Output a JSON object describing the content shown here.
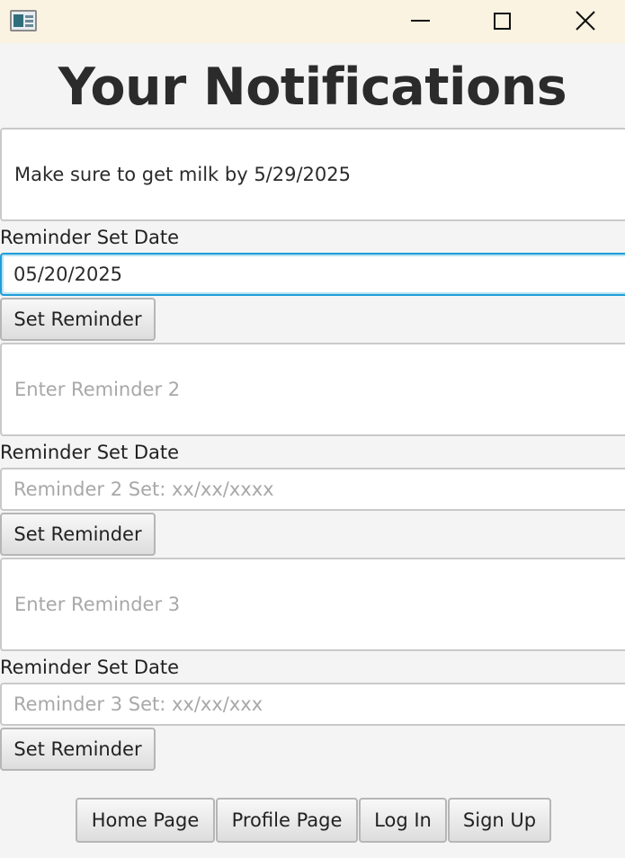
{
  "window": {
    "icons": {
      "app": "app-window-icon",
      "minimize": "minimize-icon",
      "maximize": "maximize-icon",
      "close": "close-icon"
    }
  },
  "page_title": "Your Notifications",
  "reminders": [
    {
      "text_value": "Make sure to get milk by 5/29/2025",
      "text_placeholder": "",
      "date_label": "Reminder Set Date",
      "date_value": "05/20/2025",
      "date_placeholder": "",
      "button_label": "Set Reminder"
    },
    {
      "text_value": "",
      "text_placeholder": "Enter Reminder 2",
      "date_label": "Reminder Set Date",
      "date_value": "",
      "date_placeholder": "Reminder 2 Set: xx/xx/xxxx",
      "button_label": "Set Reminder"
    },
    {
      "text_value": "",
      "text_placeholder": "Enter Reminder 3",
      "date_label": "Reminder Set Date",
      "date_value": "",
      "date_placeholder": "Reminder 3 Set: xx/xx/xxx",
      "button_label": "Set Reminder"
    }
  ],
  "nav": {
    "home": "Home Page",
    "profile": "Profile Page",
    "login": "Log In",
    "signup": "Sign Up"
  },
  "colors": {
    "titlebar": "#faf3e1",
    "background": "#f4f4f4",
    "focus_accent": "#1f9ed8"
  }
}
